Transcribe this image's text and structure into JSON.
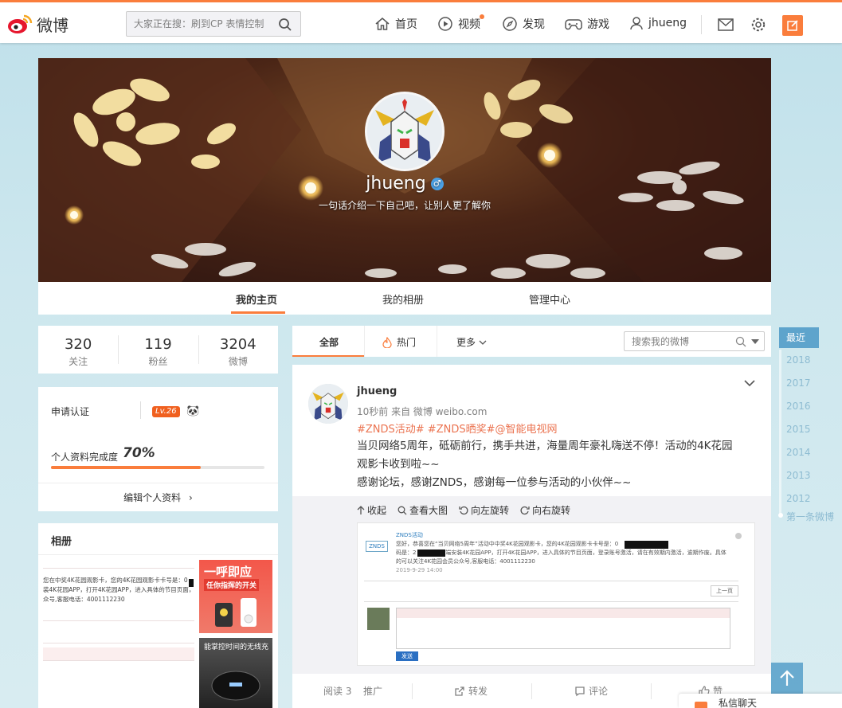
{
  "topbar": {
    "logo_text": "微博",
    "search_placeholder": "大家正在搜：刷到CP 表情控制",
    "nav": [
      {
        "label": "首页",
        "icon": "home-icon"
      },
      {
        "label": "视频",
        "icon": "video-icon"
      },
      {
        "label": "发现",
        "icon": "compass-icon"
      },
      {
        "label": "游戏",
        "icon": "gamepad-icon"
      },
      {
        "label": "jhueng",
        "icon": "user-icon"
      }
    ],
    "accent": "#fa7d3c"
  },
  "profile": {
    "name": "jhueng",
    "gender_symbol": "♂",
    "bio": "一句话介绍一下自己吧，让别人更了解你",
    "tabs": [
      "我的主页",
      "我的相册",
      "管理中心"
    ],
    "active_tab": "我的主页"
  },
  "stats": [
    {
      "value": "320",
      "label": "关注"
    },
    {
      "value": "119",
      "label": "粉丝"
    },
    {
      "value": "3204",
      "label": "微博"
    }
  ],
  "verify": {
    "apply_label": "申请认证",
    "level": "Lv.26",
    "completion_label": "个人资料完成度",
    "completion_pct": "70%",
    "completion_value": 0.7,
    "edit_label": "编辑个人资料",
    "edit_arrow": "›"
  },
  "album": {
    "title": "相册",
    "doc_lines": [
      "您在中奖4K花园观影卡，您的4K花园观影卡卡号是：0",
      "装4K花园APP，打开4K花园APP，进入具体的节目页面，",
      "众号,客服电话：4001112230"
    ],
    "thumb1_title": "一呼即应",
    "thumb1_sub": "任你指挥的开关",
    "thumb2_title": "能掌控时间的无线充"
  },
  "feed": {
    "tabs": [
      "全部",
      "热门",
      "更多"
    ],
    "search_placeholder": "搜索我的微博"
  },
  "post": {
    "author": "jhueng",
    "meta": "10秒前 来自 微博 weibo.com",
    "tags": "#ZNDS活动# #ZNDS晒奖#@智能电视网",
    "text_lines": [
      "当贝网络5周年，砥砺前行，携手共进，海量周年豪礼嗨送不停！活动的4K花园",
      "观影卡收到啦~~",
      "感谢论坛，感谢ZNDS，感谢每一位参与活动的小伙伴~~"
    ],
    "media_actions": [
      "收起",
      "查看大图",
      "向左旋转",
      "向右旋转"
    ],
    "shot": {
      "logo": "ZNDS",
      "sender": "ZNDS活动",
      "line1": "您好，恭喜您在“当贝网络5周年”活动中中奖4K花园观影卡，您的4K花园观影卡卡号是：0",
      "line2": "码是：2                  9，请在TV端安装4K花园APP，打开4K花园APP，进入具体的节目页面，登录账号激活，请在有效期内激活，逾期作废。具体的可以关注4K花园会员公众号,客服电话：4001112230",
      "date": "2019-9-29 14:00",
      "prev": "上一页",
      "send": "发送"
    },
    "footer": {
      "read": "阅读 3",
      "promote": "推广",
      "repost": "转发",
      "comment": "评论",
      "like": "赞"
    }
  },
  "timeline": {
    "recent": "最近",
    "years": [
      "2018",
      "2017",
      "2016",
      "2015",
      "2014",
      "2013",
      "2012"
    ],
    "first": "第一条微博"
  },
  "chat": {
    "label": "私信聊天"
  }
}
